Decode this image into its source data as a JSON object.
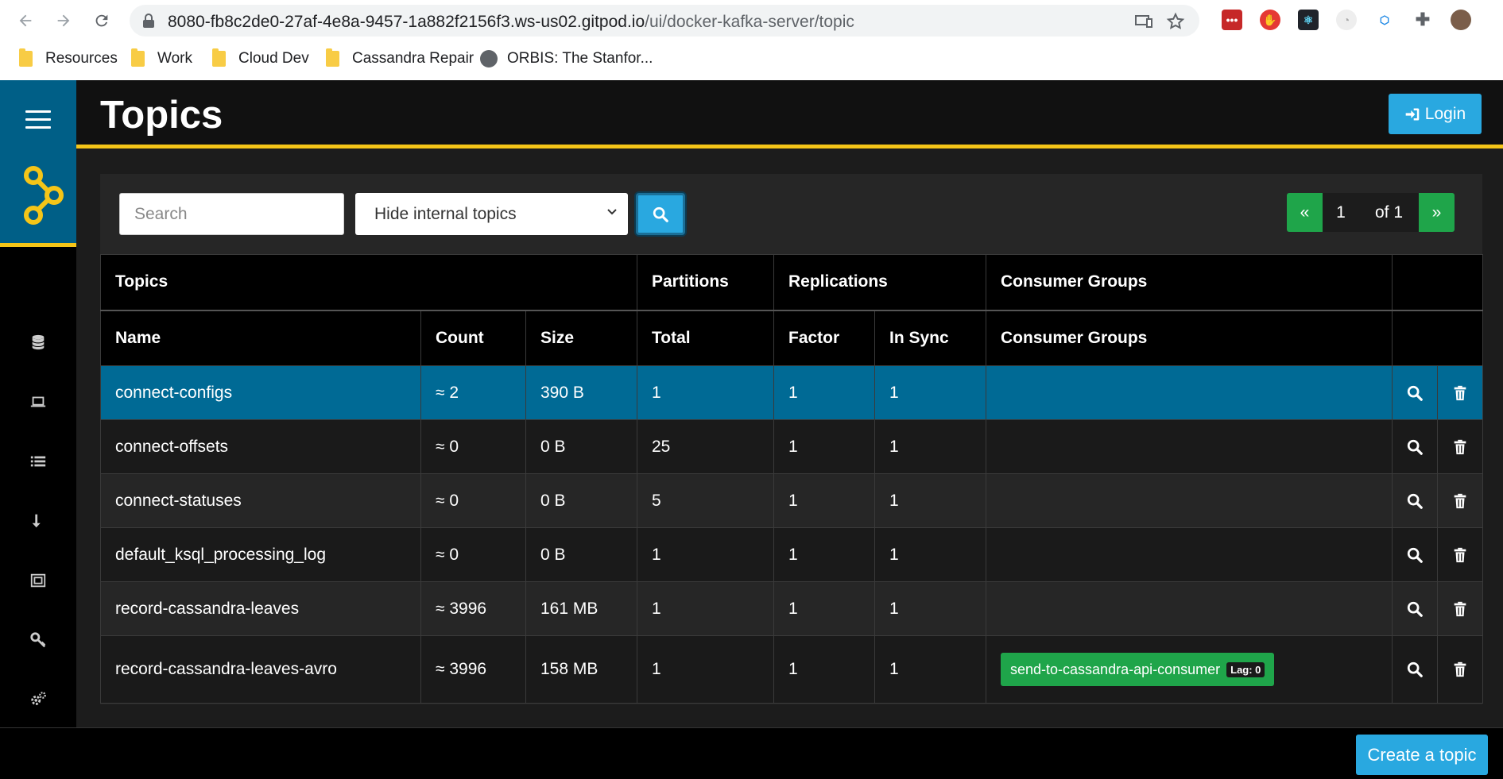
{
  "browser": {
    "url_host": "8080-fb8c2de0-27af-4e8a-9457-1a882f2156f3.ws-us02.gitpod.io",
    "url_path": "/ui/docker-kafka-server/topic",
    "bookmarks": [
      "Resources",
      "Work",
      "Cloud Dev",
      "Cassandra Repair",
      "ORBIS: The Stanfor..."
    ]
  },
  "header": {
    "title": "Topics",
    "login_label": "Login"
  },
  "toolbar": {
    "search_placeholder": "Search",
    "filter_selected": "Hide internal topics",
    "page_prev": "«",
    "page_current": "1",
    "page_of": "of 1",
    "page_next": "»"
  },
  "table": {
    "group_headers": [
      "Topics",
      "Partitions",
      "Replications",
      "Consumer Groups"
    ],
    "columns": [
      "Name",
      "Count",
      "Size",
      "Total",
      "Factor",
      "In Sync",
      "Consumer Groups"
    ],
    "rows": [
      {
        "name": "connect-configs",
        "count": "≈ 2",
        "size": "390 B",
        "total": "1",
        "factor": "1",
        "in_sync": "1",
        "consumer_group": "",
        "lag": ""
      },
      {
        "name": "connect-offsets",
        "count": "≈ 0",
        "size": "0 B",
        "total": "25",
        "factor": "1",
        "in_sync": "1",
        "consumer_group": "",
        "lag": ""
      },
      {
        "name": "connect-statuses",
        "count": "≈ 0",
        "size": "0 B",
        "total": "5",
        "factor": "1",
        "in_sync": "1",
        "consumer_group": "",
        "lag": ""
      },
      {
        "name": "default_ksql_processing_log",
        "count": "≈ 0",
        "size": "0 B",
        "total": "1",
        "factor": "1",
        "in_sync": "1",
        "consumer_group": "",
        "lag": ""
      },
      {
        "name": "record-cassandra-leaves",
        "count": "≈ 3996",
        "size": "161 MB",
        "total": "1",
        "factor": "1",
        "in_sync": "1",
        "consumer_group": "",
        "lag": ""
      },
      {
        "name": "record-cassandra-leaves-avro",
        "count": "≈ 3996",
        "size": "158 MB",
        "total": "1",
        "factor": "1",
        "in_sync": "1",
        "consumer_group": "send-to-cassandra-api-consumer",
        "lag": "Lag: 0"
      }
    ]
  },
  "footer": {
    "create_label": "Create a topic"
  },
  "colors": {
    "accent": "#f5c518",
    "primary": "#29a8e0",
    "success": "#1fa54a",
    "highlight_row": "#006a95",
    "sidebar_top": "#005f87"
  }
}
